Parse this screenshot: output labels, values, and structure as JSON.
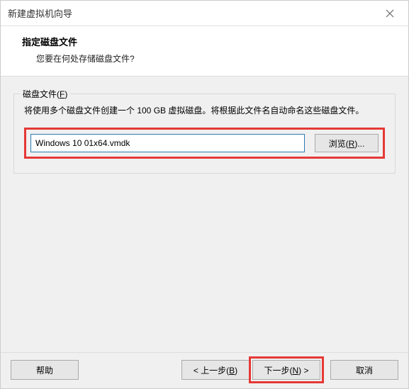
{
  "window": {
    "title": "新建虚拟机向导"
  },
  "header": {
    "title": "指定磁盘文件",
    "subtitle": "您要在何处存储磁盘文件?"
  },
  "fieldset": {
    "legend_pre": "磁盘文件(",
    "legend_key": "F",
    "legend_post": ")",
    "description": "将使用多个磁盘文件创建一个 100 GB 虚拟磁盘。将根据此文件名自动命名这些磁盘文件。",
    "path_value": "Windows 10 01x64.vmdk",
    "browse_pre": "浏览(",
    "browse_key": "R",
    "browse_post": ")..."
  },
  "footer": {
    "help": "帮助",
    "back_pre": "< 上一步(",
    "back_key": "B",
    "back_post": ")",
    "next_pre": "下一步(",
    "next_key": "N",
    "next_post": ") >",
    "cancel": "取消"
  }
}
